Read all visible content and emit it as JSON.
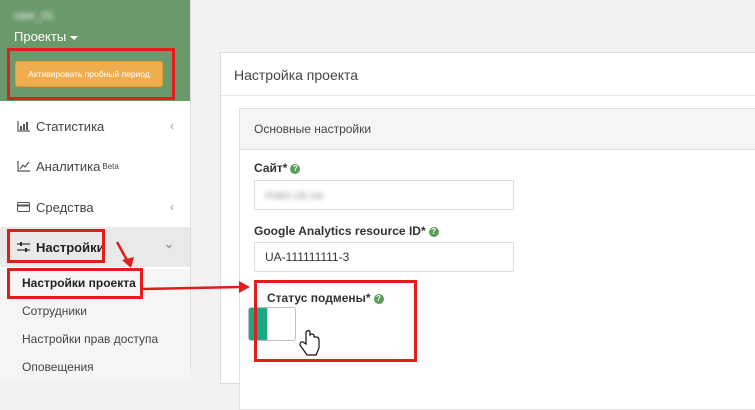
{
  "sidebar": {
    "user_blurred": "user_01",
    "projects_label": "Проекты",
    "trial_button": "Активировать пробный период",
    "items": [
      {
        "label": "Статистика",
        "icon": "bar-chart-icon",
        "chevron": "‹"
      },
      {
        "label": "Аналитика",
        "icon": "line-chart-icon",
        "badge": "Beta"
      },
      {
        "label": "Средства",
        "icon": "credit-card-icon",
        "chevron": "‹"
      },
      {
        "label": "Настройки",
        "icon": "sliders-icon",
        "chevron": "⌄"
      }
    ],
    "submenu": [
      {
        "label": "Настройки проекта"
      },
      {
        "label": "Сотрудники"
      },
      {
        "label": "Настройки прав доступа"
      },
      {
        "label": "Оповещения"
      }
    ]
  },
  "panel": {
    "title": "Настройка проекта",
    "section_title": "Основные настройки",
    "site_label": "Сайт*",
    "site_value": "main.ck.ua",
    "ga_label": "Google Analytics resource ID*",
    "ga_value": "UA-111111111-3",
    "status_label": "Статус подмены*",
    "help_glyph": "?"
  },
  "colors": {
    "sidebar_header": "#6a9a6b",
    "trial_button": "#f0ad4e",
    "toggle_on": "#1aaa83",
    "annotation": "#e11d1d",
    "help_icon": "#5a9e5c"
  }
}
